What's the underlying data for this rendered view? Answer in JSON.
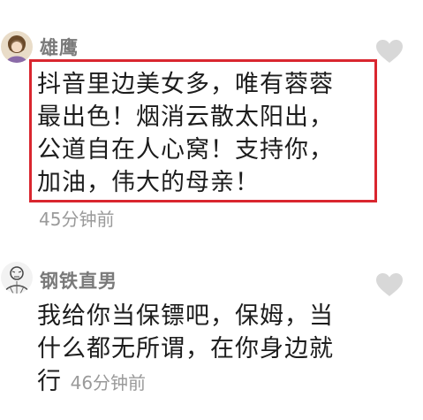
{
  "comments": [
    {
      "user": "雄鹰",
      "lines": [
        "抖音里边美女多，唯有蓉蓉",
        "最出色！烟消云散太阳出，",
        "公道自在人心窝！支持你，",
        "加油，伟大的母亲！"
      ],
      "time": "45分钟前",
      "avatar_icon": "girl-avatar-icon",
      "like_icon": "heart-icon",
      "highlight_color": "#d9262f"
    },
    {
      "user": "钢铁直男",
      "lines": [
        "我给你当保镖吧，保姆，当",
        "什么都无所谓，在你身边就",
        "行"
      ],
      "time": "46分钟前",
      "avatar_icon": "sketch-man-avatar-icon",
      "like_icon": "heart-icon"
    }
  ]
}
